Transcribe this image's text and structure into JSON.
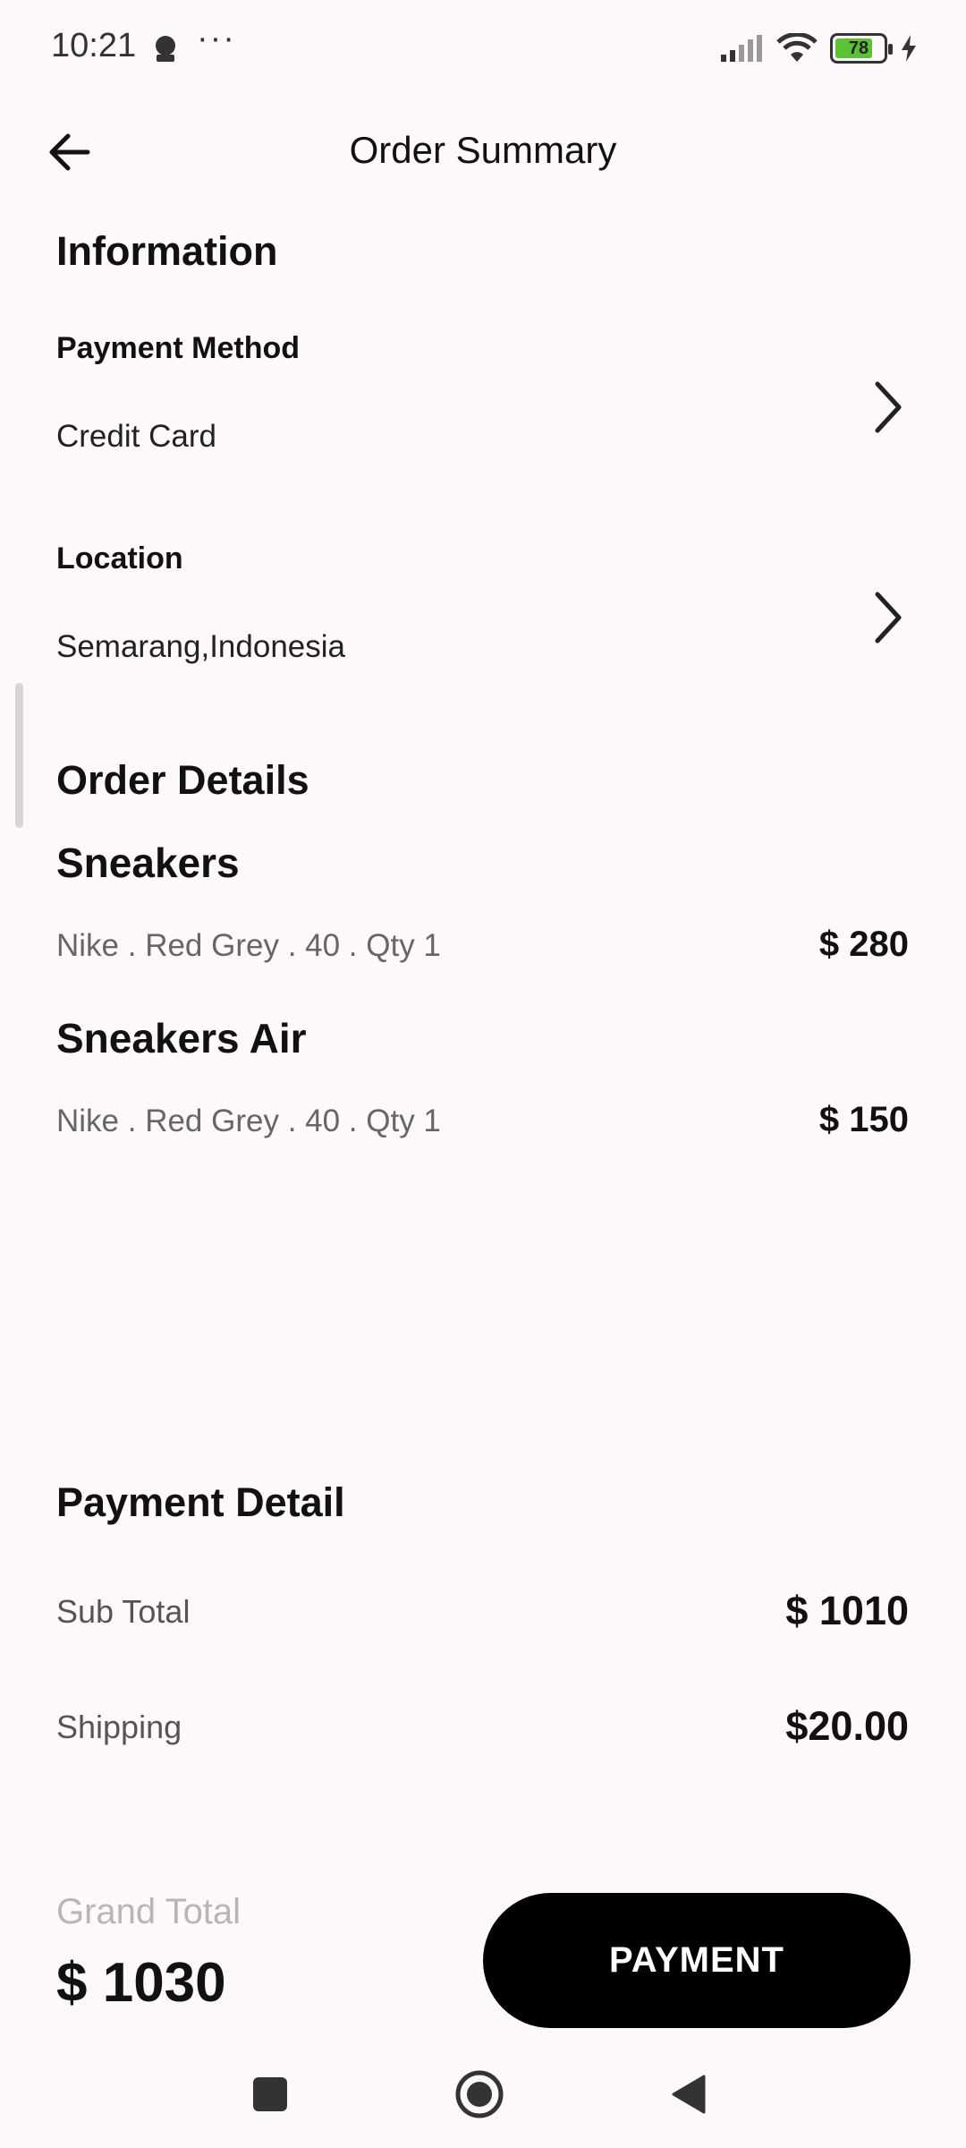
{
  "status_bar": {
    "time": "10:21",
    "dots": "···",
    "battery": "78",
    "battery_level_pct": 78
  },
  "header": {
    "title": "Order Summary",
    "back_icon": "arrow-left-icon"
  },
  "information": {
    "section_title": "Information",
    "payment_method": {
      "label": "Payment Method",
      "value": "Credit Card",
      "icon": "chevron-right-icon"
    },
    "location": {
      "label": "Location",
      "value": "Semarang,Indonesia",
      "icon": "chevron-right-icon"
    }
  },
  "order_details": {
    "section_title": "Order Details",
    "items": [
      {
        "name": "Sneakers",
        "desc": "Nike . Red Grey . 40 . Qty 1",
        "price": "$ 280"
      },
      {
        "name": "Sneakers Air",
        "desc": "Nike . Red Grey . 40 . Qty 1",
        "price": "$ 150"
      }
    ]
  },
  "payment_detail": {
    "section_title": "Payment Detail",
    "rows": [
      {
        "label": "Sub Total",
        "value": "$ 1010"
      },
      {
        "label": "Shipping",
        "value": "$20.00"
      }
    ]
  },
  "footer": {
    "grand_total_label": "Grand Total",
    "grand_total_value": "$ 1030",
    "payment_button": "PAYMENT"
  },
  "colors": {
    "background": "#fdf8fc",
    "button": "#000000",
    "battery": "#5bc236"
  }
}
